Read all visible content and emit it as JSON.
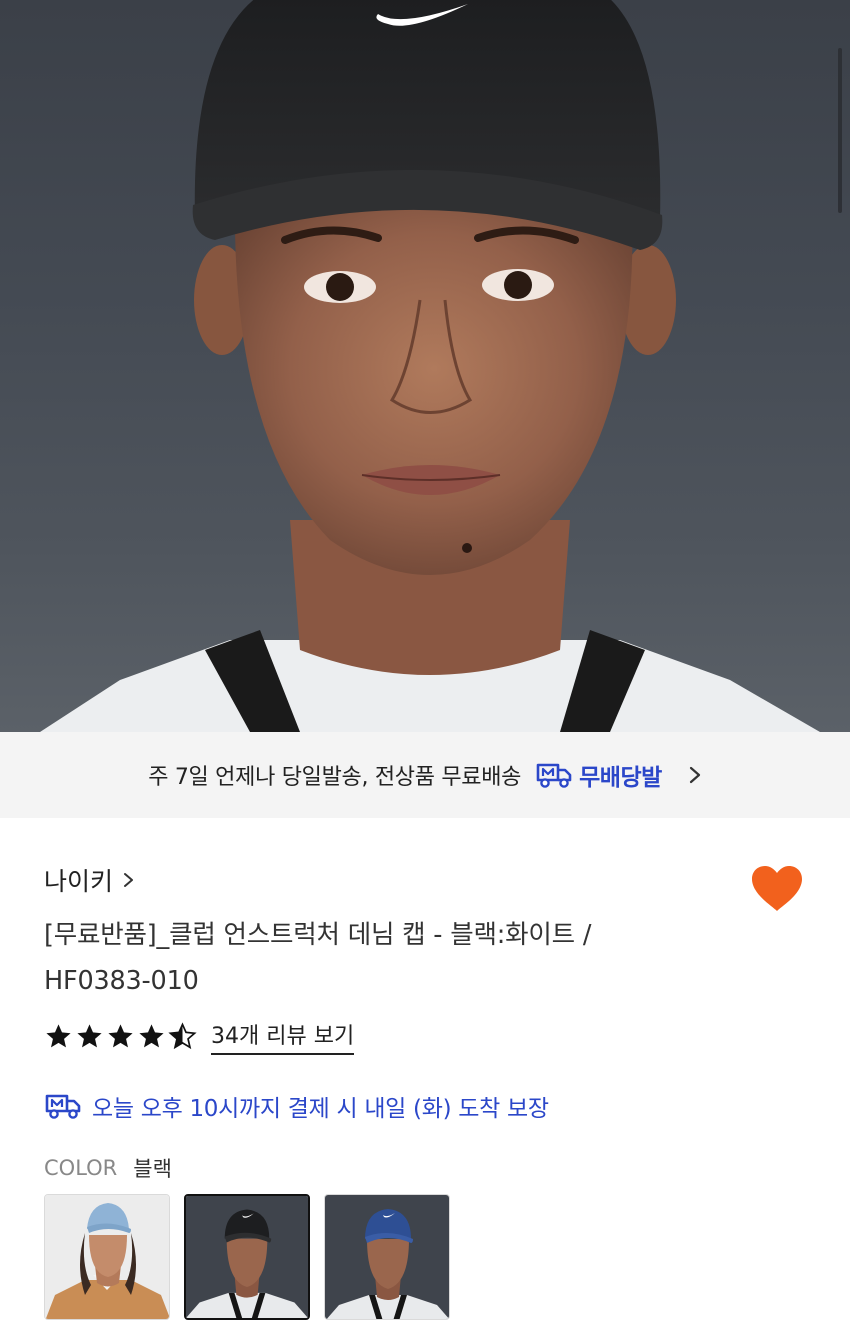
{
  "banner": {
    "text": "주 7일 언제나 당일발송, 전상품 무료배송",
    "badge_label": "무배당발",
    "icon": "truck-icon"
  },
  "product": {
    "brand": "나이키",
    "title": "[무료반품]_클럽 언스트럭처 데님 캡 - 블랙:화이트 / HF0383-010",
    "rating": 4.5,
    "review_link": "34개 리뷰 보기",
    "delivery_notice": "오늘 오후 10시까지 결제 시 내일 (화) 도착 보장",
    "wishlisted": true,
    "color_label": "COLOR",
    "color_value": "블랙",
    "swatches": [
      {
        "name": "light-blue",
        "selected": false
      },
      {
        "name": "black",
        "selected": true
      },
      {
        "name": "navy",
        "selected": false
      }
    ]
  },
  "colors": {
    "accent_blue": "#2b47c9",
    "heart": "#f2611d",
    "banner_bg": "#f4f4f4"
  }
}
